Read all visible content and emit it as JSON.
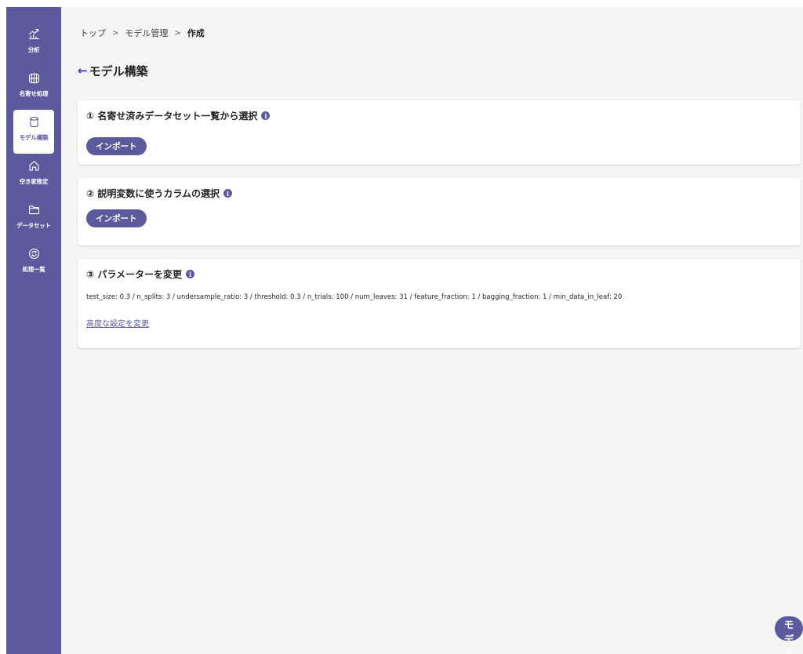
{
  "sidebar": {
    "items": [
      {
        "label": "分析",
        "icon": "analytics-icon"
      },
      {
        "label": "名寄せ処理",
        "icon": "globe-icon"
      },
      {
        "label": "モデル構築",
        "icon": "database-icon",
        "active": true
      },
      {
        "label": "空き家推定",
        "icon": "home-icon"
      },
      {
        "label": "データセット",
        "icon": "folder-icon"
      },
      {
        "label": "処理一覧",
        "icon": "refresh-icon"
      }
    ]
  },
  "breadcrumb": {
    "items": [
      "トップ",
      "モデル管理",
      "作成"
    ],
    "separator": ">"
  },
  "page": {
    "back_arrow": "←",
    "title": "モデル構築"
  },
  "cards": {
    "dataset": {
      "title": "① 名寄せ済みデータセット一覧から選択",
      "button": "インポート"
    },
    "columns": {
      "title": "② 説明変数に使うカラムの選択",
      "button": "インポート"
    },
    "params": {
      "title": "③ パラメーターを変更",
      "values": "test_size: 0.3 / n_splits: 3 / undersample_ratio: 3 / threshold: 0.3 / n_trials: 100 / num_leaves: 31 / feature_fraction: 1 / bagging_fraction: 1 / min_data_in_leaf: 20",
      "link": "高度な設定を変更"
    }
  },
  "info_glyph": "i",
  "submit_button": "モデル構築",
  "colors": {
    "accent": "#5b5a9c",
    "back_arrow": "#3b37c8",
    "background": "#f5f5f5"
  }
}
